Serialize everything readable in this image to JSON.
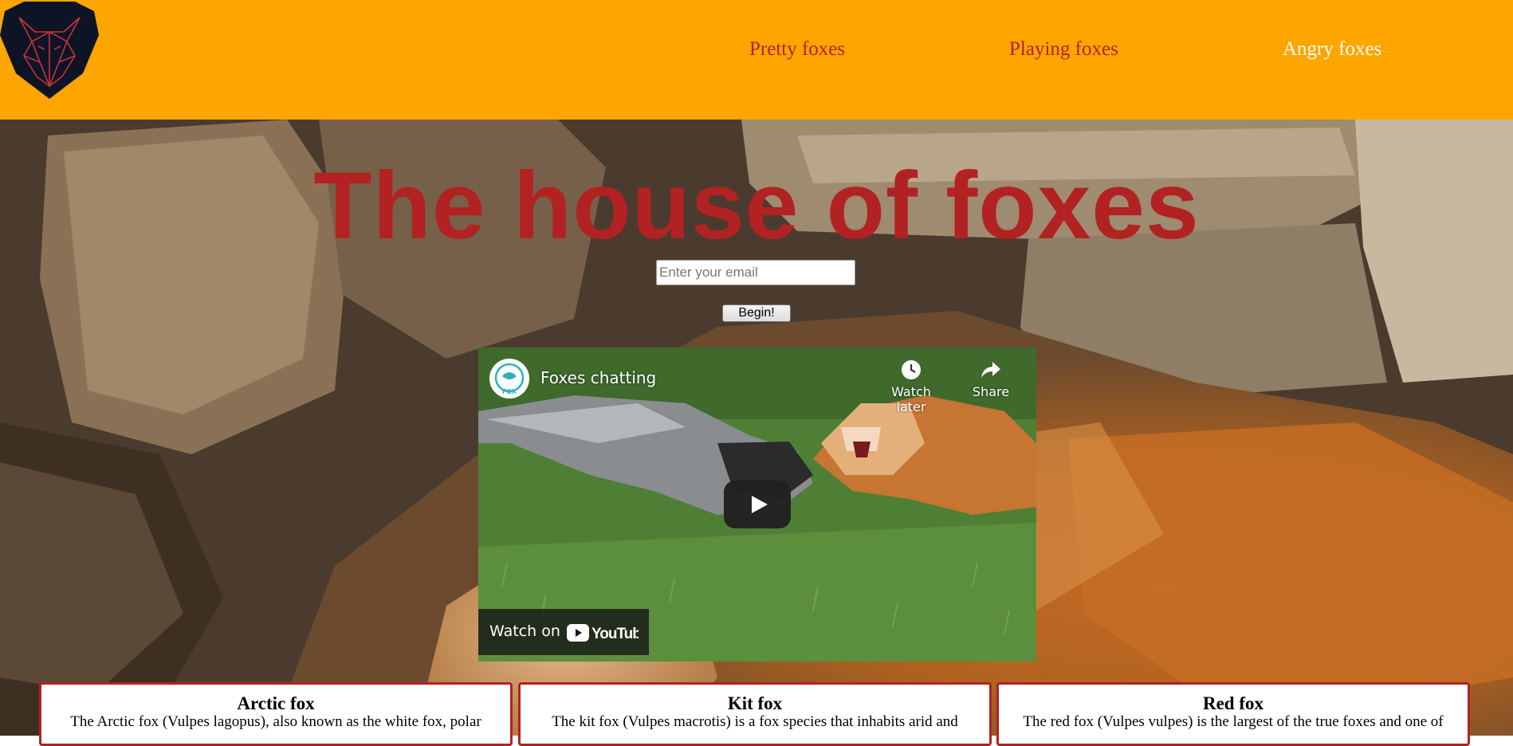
{
  "nav": {
    "links": [
      "Pretty foxes",
      "Playing foxes",
      "Angry foxes"
    ]
  },
  "hero": {
    "title": "The house of foxes",
    "email_placeholder": "Enter your email",
    "begin_label": "Begin!"
  },
  "video": {
    "title": "Foxes chatting",
    "channel_badge": "FOX",
    "watch_later": "Watch later",
    "share": "Share",
    "watch_on": "Watch on",
    "brand": "YouTube"
  },
  "cards": [
    {
      "title": "Arctic fox",
      "text": "The Arctic fox (Vulpes lagopus), also known as the white fox, polar"
    },
    {
      "title": "Kit fox",
      "text": "The kit fox (Vulpes macrotis) is a fox species that inhabits arid and"
    },
    {
      "title": "Red fox",
      "text": "The red fox (Vulpes vulpes) is the largest of the true foxes and one of"
    }
  ],
  "colors": {
    "nav_bg": "#ffa500",
    "accent": "#b22222",
    "logo_bg": "#0d1426"
  },
  "icons": [
    "fox-logo-icon",
    "clock-icon",
    "share-icon",
    "play-icon",
    "youtube-logo-icon"
  ]
}
